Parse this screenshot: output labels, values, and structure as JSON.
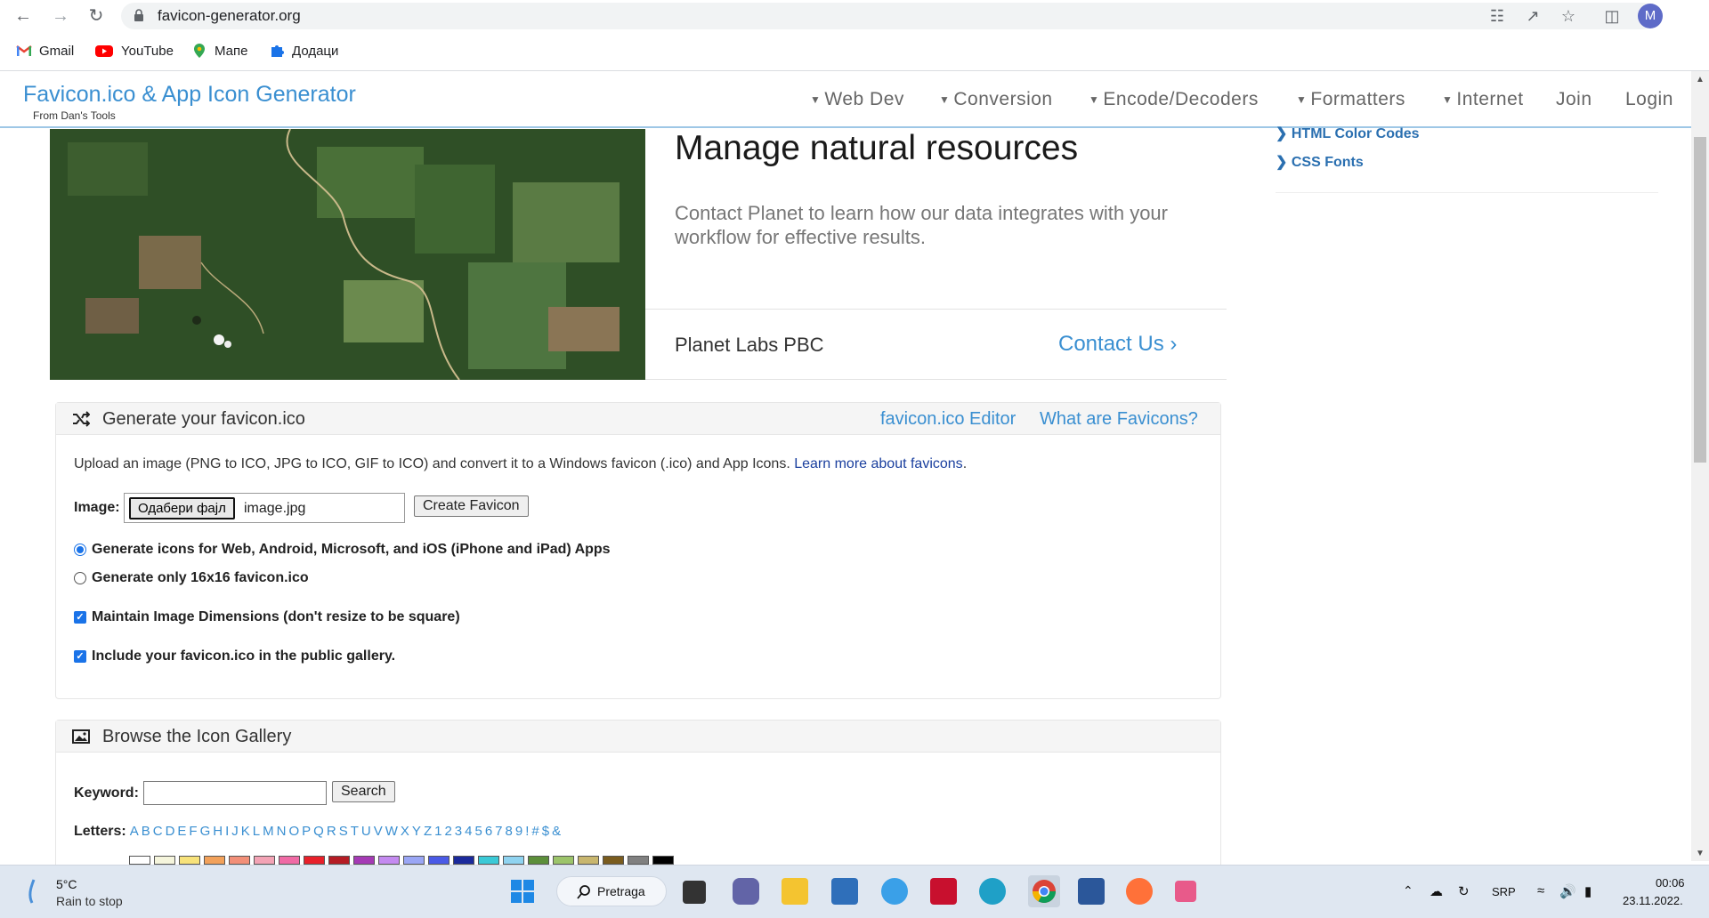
{
  "browser": {
    "url": "favicon-generator.org",
    "bookmarks": [
      "Gmail",
      "YouTube",
      "Мапе",
      "Додаци"
    ],
    "profile_initial": "M"
  },
  "site": {
    "brand": "Favicon.ico & App Icon Generator",
    "brand_sub": "From Dan's Tools",
    "nav": [
      "Web Dev",
      "Conversion",
      "Encode/Decoders",
      "Formatters",
      "Internet",
      "Join",
      "Login"
    ]
  },
  "ad": {
    "title": "Manage natural resources",
    "text": "Contact Planet to learn how our data integrates with your workflow for effective results.",
    "company": "Planet Labs PBC",
    "cta": "Contact Us"
  },
  "sidebar": {
    "links": [
      "HTML Color Codes",
      "CSS Fonts"
    ]
  },
  "generate": {
    "title": "Generate your favicon.ico",
    "links": [
      "favicon.ico Editor",
      "What are Favicons?"
    ],
    "description": "Upload an image (PNG to ICO, JPG to ICO, GIF to ICO) and convert it to a Windows favicon (.ico) and App Icons.",
    "learn_more": "Learn more about favicons",
    "desc_end": ".",
    "image_label": "Image:",
    "file_button": "Одабери фајл",
    "file_name": "image.jpg",
    "create_button": "Create Favicon",
    "options": [
      {
        "label": "Generate icons for Web, Android, Microsoft, and iOS (iPhone and iPad) Apps",
        "type": "radio",
        "checked": true
      },
      {
        "label": "Generate only 16x16 favicon.ico",
        "type": "radio",
        "checked": false
      },
      {
        "label": "Maintain Image Dimensions (don't resize to be square)",
        "type": "checkbox",
        "checked": true
      },
      {
        "label": "Include your favicon.ico in the public gallery.",
        "type": "checkbox",
        "checked": true
      }
    ]
  },
  "gallery": {
    "title": "Browse the Icon Gallery",
    "keyword_label": "Keyword:",
    "search_button": "Search",
    "letters_label": "Letters:",
    "letters": [
      "A",
      "B",
      "C",
      "D",
      "E",
      "F",
      "G",
      "H",
      "I",
      "J",
      "K",
      "L",
      "M",
      "N",
      "O",
      "P",
      "Q",
      "R",
      "S",
      "T",
      "U",
      "V",
      "W",
      "X",
      "Y",
      "Z",
      "1",
      "2",
      "3",
      "4",
      "5",
      "6",
      "7",
      "8",
      "9",
      "!",
      "#",
      "$",
      "&"
    ],
    "swatch_colors": [
      "#ffffff",
      "#f5f5dc",
      "#f7e27a",
      "#f2a15a",
      "#f28f78",
      "#f3a3b5",
      "#f06aa5",
      "#e8202a",
      "#b51c24",
      "#a53ab5",
      "#c48af0",
      "#9aa6f5",
      "#4a5ae6",
      "#1b2a9c",
      "#3ac9d6",
      "#8fd3f0",
      "#5c8f3a",
      "#9cc46a",
      "#c8b66e",
      "#7a5c1e",
      "#808080",
      "#000000"
    ]
  },
  "taskbar": {
    "temp": "5°C",
    "weather": "Rain to stop",
    "search": "Pretraga",
    "lang": "SRP",
    "time": "00:06",
    "date": "23.11.2022."
  }
}
